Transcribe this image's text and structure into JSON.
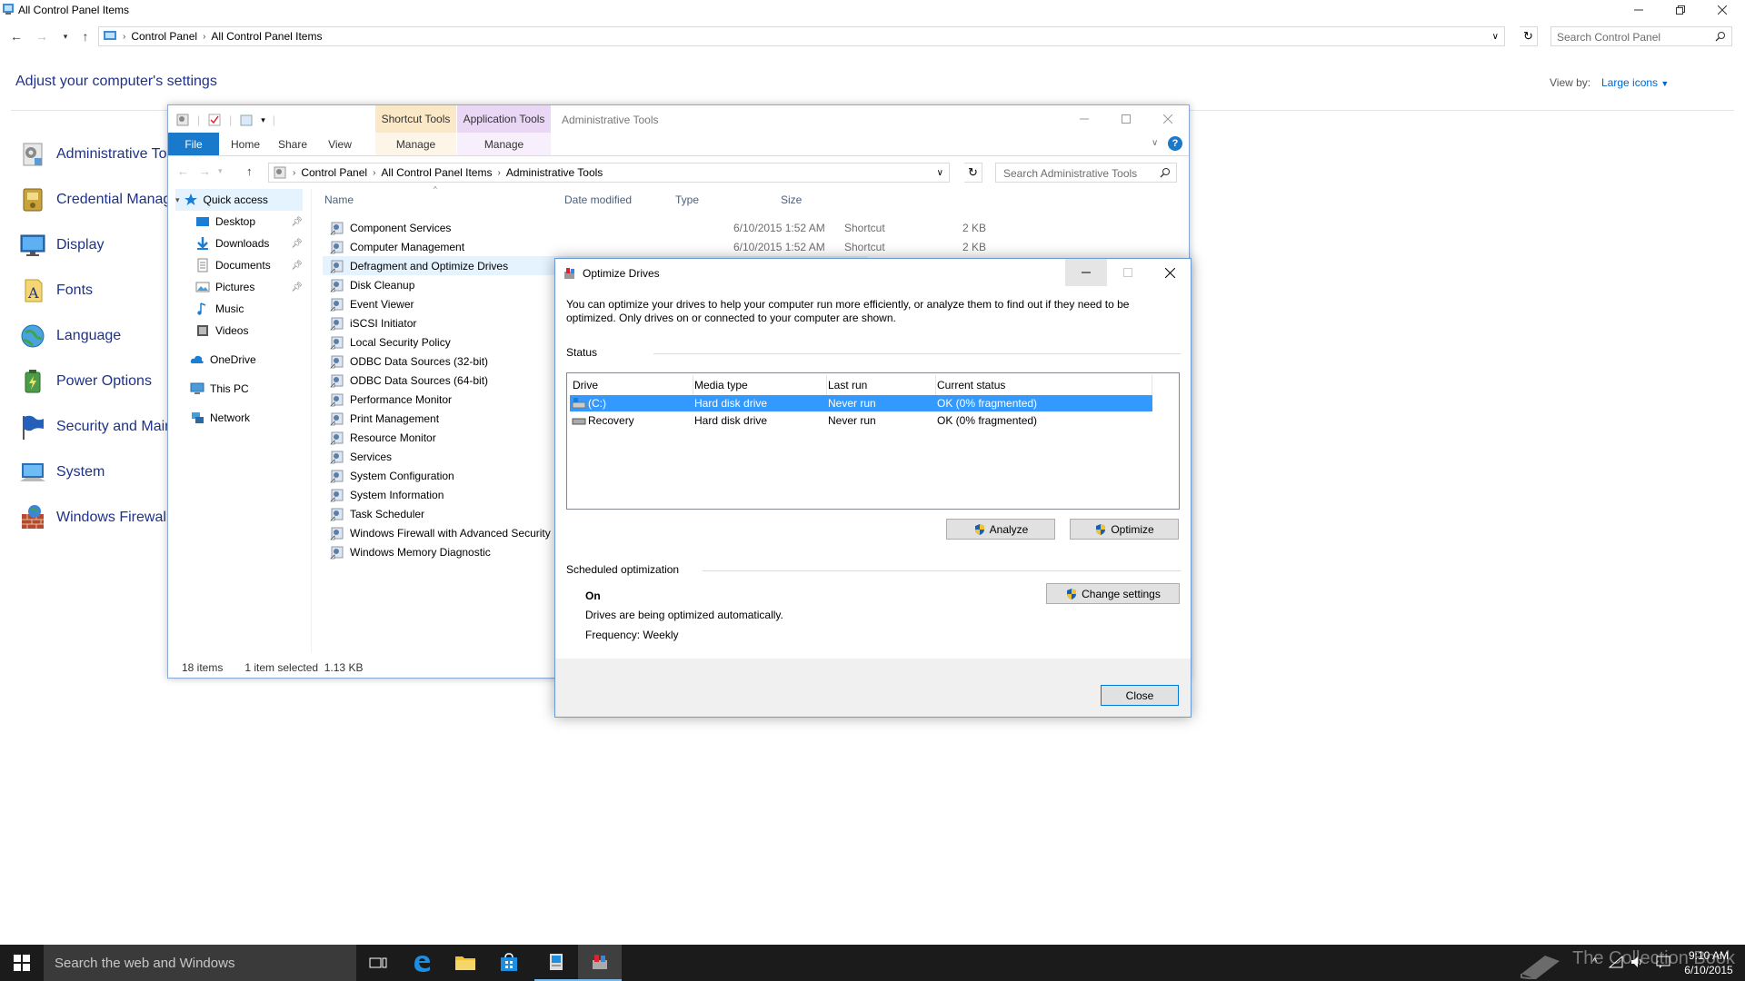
{
  "control_panel": {
    "window_title": "All Control Panel Items",
    "breadcrumbs": [
      "Control Panel",
      "All Control Panel Items"
    ],
    "search_placeholder": "Search Control Panel",
    "heading": "Adjust your computer's settings",
    "view_by_label": "View by:",
    "view_by_value": "Large icons",
    "items": [
      {
        "label": "Administrative Tools",
        "icon": "admin-tools-icon"
      },
      {
        "label": "Credential Manager",
        "icon": "credential-manager-icon"
      },
      {
        "label": "Display",
        "icon": "display-icon"
      },
      {
        "label": "Fonts",
        "icon": "fonts-icon"
      },
      {
        "label": "Language",
        "icon": "language-icon"
      },
      {
        "label": "Power Options",
        "icon": "power-options-icon"
      },
      {
        "label": "Security and Maintenance",
        "icon": "security-flag-icon"
      },
      {
        "label": "System",
        "icon": "system-icon"
      },
      {
        "label": "Windows Firewall",
        "icon": "firewall-icon"
      }
    ]
  },
  "explorer": {
    "title": "Administrative Tools",
    "context_tabs": {
      "shortcut_tools": "Shortcut Tools",
      "application_tools": "Application Tools"
    },
    "ribbon_tabs": [
      "File",
      "Home",
      "Share",
      "View",
      "Manage",
      "Manage"
    ],
    "breadcrumbs": [
      "Control Panel",
      "All Control Panel Items",
      "Administrative Tools"
    ],
    "search_placeholder": "Search Administrative Tools",
    "nav": {
      "quick_access": "Quick access",
      "pinned": [
        "Desktop",
        "Downloads",
        "Documents",
        "Pictures"
      ],
      "other": [
        "Music",
        "Videos"
      ],
      "onedrive": "OneDrive",
      "this_pc": "This PC",
      "network": "Network"
    },
    "columns": {
      "name": "Name",
      "date": "Date modified",
      "type": "Type",
      "size": "Size"
    },
    "files": [
      {
        "name": "Component Services",
        "date": "6/10/2015 1:52 AM",
        "type": "Shortcut",
        "size": "2 KB"
      },
      {
        "name": "Computer Management",
        "date": "6/10/2015 1:52 AM",
        "type": "Shortcut",
        "size": "2 KB"
      },
      {
        "name": "Defragment and Optimize Drives",
        "date": "",
        "type": "",
        "size": ""
      },
      {
        "name": "Disk Cleanup"
      },
      {
        "name": "Event Viewer"
      },
      {
        "name": "iSCSI Initiator"
      },
      {
        "name": "Local Security Policy"
      },
      {
        "name": "ODBC Data Sources (32-bit)"
      },
      {
        "name": "ODBC Data Sources (64-bit)"
      },
      {
        "name": "Performance Monitor"
      },
      {
        "name": "Print Management"
      },
      {
        "name": "Resource Monitor"
      },
      {
        "name": "Services"
      },
      {
        "name": "System Configuration"
      },
      {
        "name": "System Information"
      },
      {
        "name": "Task Scheduler"
      },
      {
        "name": "Windows Firewall with Advanced Security"
      },
      {
        "name": "Windows Memory Diagnostic"
      }
    ],
    "status": {
      "count": "18 items",
      "selected": "1 item selected",
      "size": "1.13 KB"
    }
  },
  "optimize": {
    "title": "Optimize Drives",
    "description": "You can optimize your drives to help your computer run more efficiently, or analyze them to find out if they need to be optimized. Only drives on or connected to your computer are shown.",
    "status_label": "Status",
    "columns": {
      "drive": "Drive",
      "media": "Media type",
      "last_run": "Last run",
      "status": "Current status"
    },
    "drives": [
      {
        "drive": "(C:)",
        "media": "Hard disk drive",
        "last_run": "Never run",
        "status": "OK (0% fragmented)"
      },
      {
        "drive": "Recovery",
        "media": "Hard disk drive",
        "last_run": "Never run",
        "status": "OK (0% fragmented)"
      }
    ],
    "analyze_label": "Analyze",
    "optimize_label": "Optimize",
    "scheduled_label": "Scheduled optimization",
    "scheduled_state": "On",
    "scheduled_desc": "Drives are being optimized automatically.",
    "frequency": "Frequency: Weekly",
    "change_settings_label": "Change settings",
    "close_label": "Close"
  },
  "taskbar": {
    "search_placeholder": "Search the web and Windows",
    "watermark": "The Collection Book",
    "time": "9:10 AM",
    "date": "6/10/2015"
  },
  "colors": {
    "accent": "#0078d7",
    "selection": "#3399ff",
    "link": "#1e3287"
  }
}
